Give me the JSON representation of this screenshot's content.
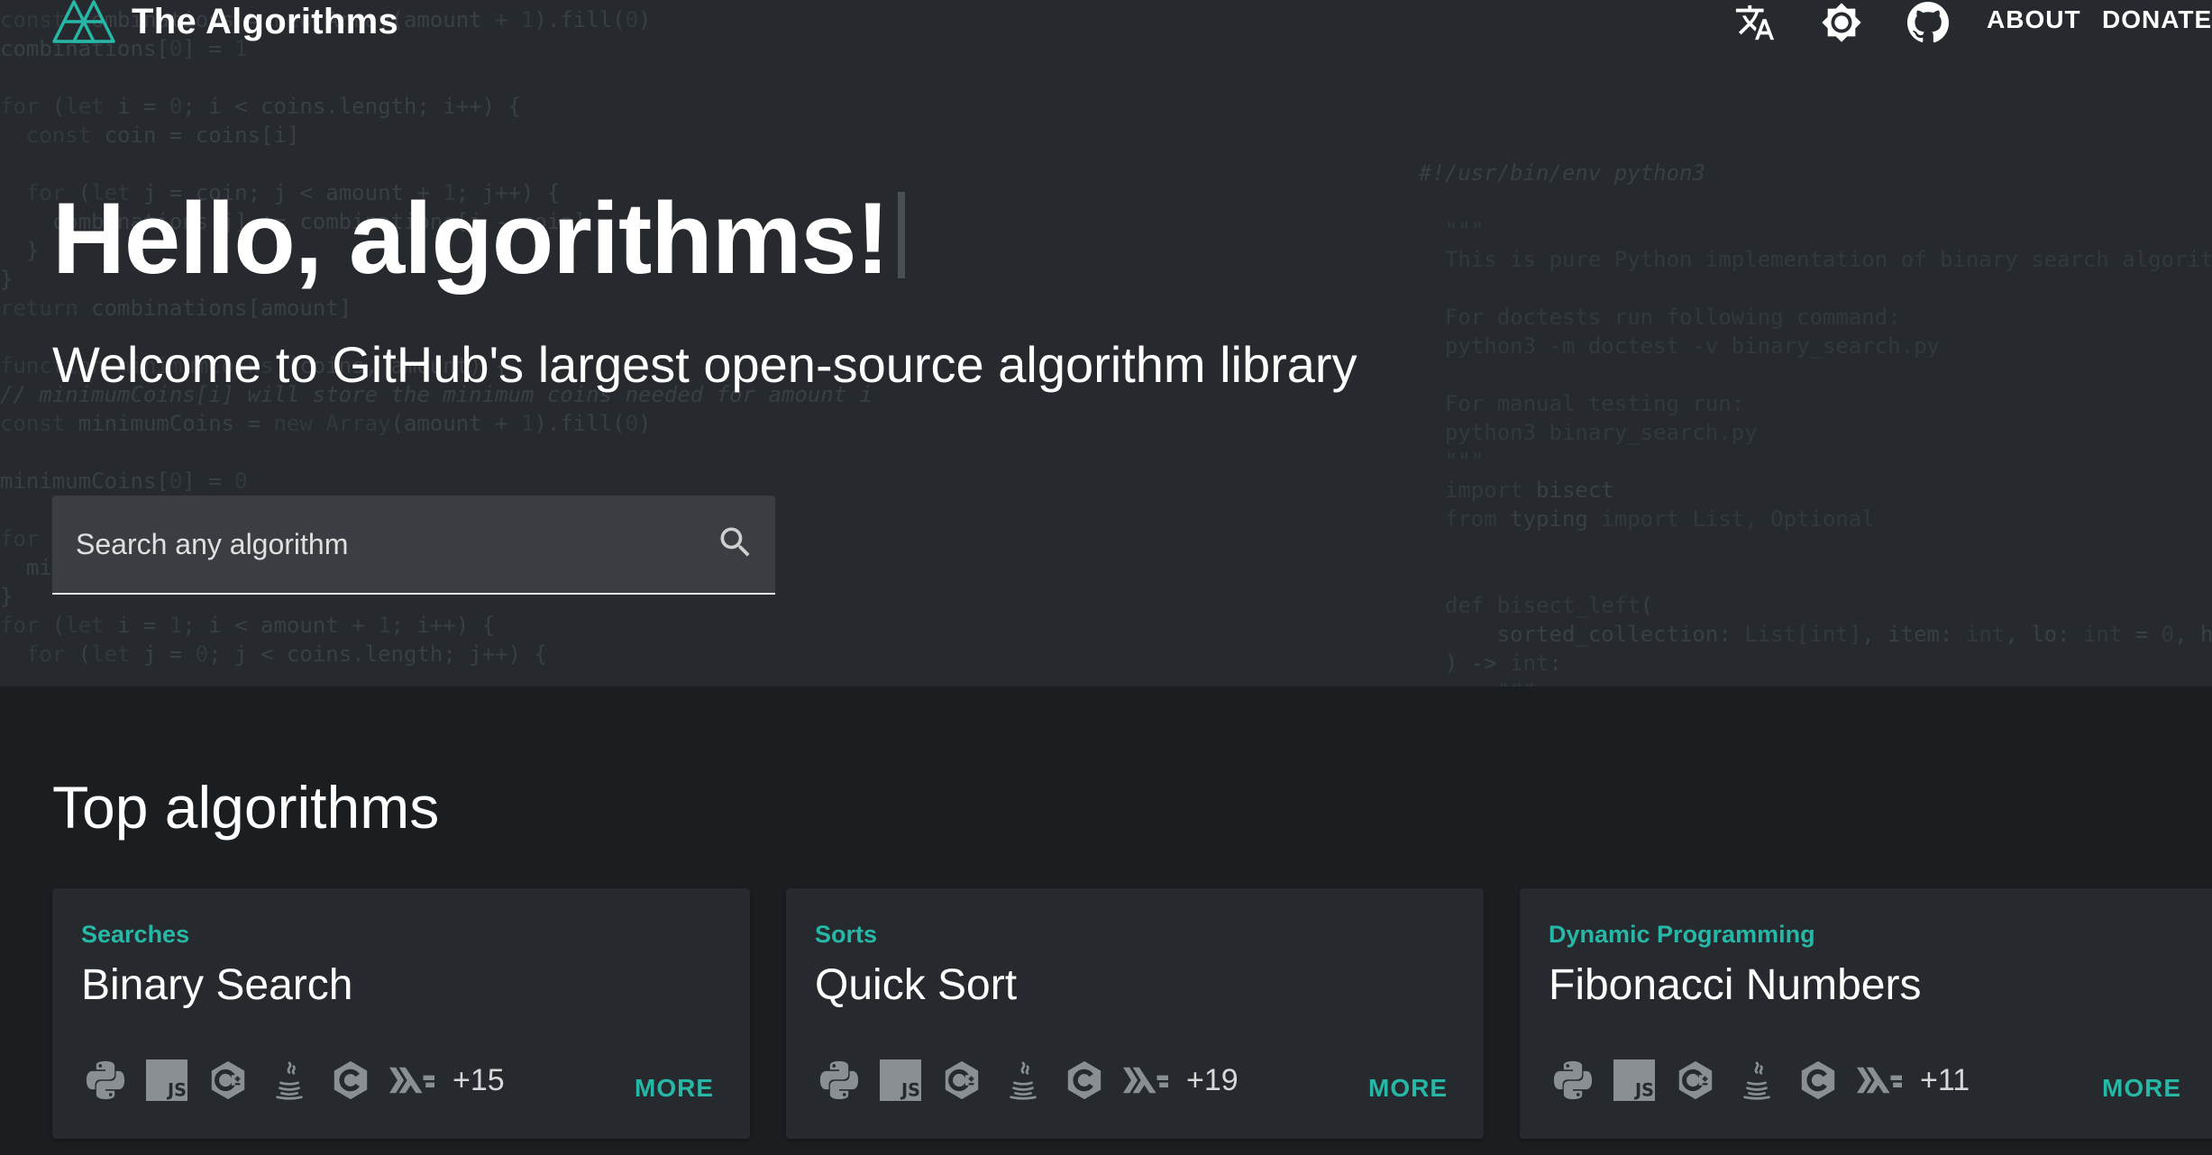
{
  "header": {
    "title": "The Algorithms",
    "nav": {
      "about": "ABOUT",
      "donate": "DONATE"
    },
    "icons": [
      "logo",
      "translate-icon",
      "theme-icon",
      "github-icon"
    ]
  },
  "hero": {
    "title": "Hello, algorithms!",
    "subtitle": "Welcome to GitHub's largest open-source algorithm library",
    "search": {
      "placeholder": "Search any algorithm"
    }
  },
  "top_algorithms": {
    "heading": "Top algorithms",
    "more_label": "MORE",
    "cards": [
      {
        "category": "Searches",
        "title": "Binary Search",
        "languages": [
          "python",
          "javascript",
          "c-plus-plus",
          "java",
          "c",
          "haskell"
        ],
        "extra": "+15"
      },
      {
        "category": "Sorts",
        "title": "Quick Sort",
        "languages": [
          "python",
          "javascript",
          "c-plus-plus",
          "java",
          "c",
          "haskell"
        ],
        "extra": "+19"
      },
      {
        "category": "Dynamic Programming",
        "title": "Fibonacci Numbers",
        "languages": [
          "python",
          "javascript",
          "c-plus-plus",
          "java",
          "c",
          "haskell"
        ],
        "extra": "+11"
      }
    ]
  },
  "colors": {
    "accent": "#26b7a6",
    "hero_bg": "#262a2e",
    "page_bg": "#1a1e21",
    "card_bg": "#262a2e"
  }
}
